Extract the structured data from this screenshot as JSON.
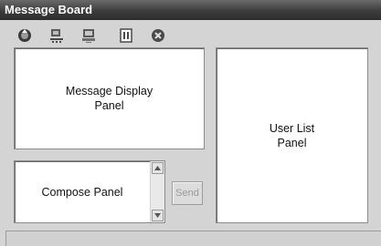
{
  "window": {
    "title": "Message Board"
  },
  "toolbar": {
    "buttons": [
      {
        "icon": "connect-icon"
      },
      {
        "icon": "network-icon"
      },
      {
        "icon": "computer-icon"
      },
      {
        "icon": "file-transfer-icon"
      },
      {
        "icon": "stop-icon"
      }
    ]
  },
  "panels": {
    "message_display": "Message Display\nPanel",
    "user_list": "User List\nPanel",
    "compose": "Compose Panel"
  },
  "send_button": {
    "label": "Send",
    "enabled": false
  },
  "status": {
    "text": ""
  }
}
